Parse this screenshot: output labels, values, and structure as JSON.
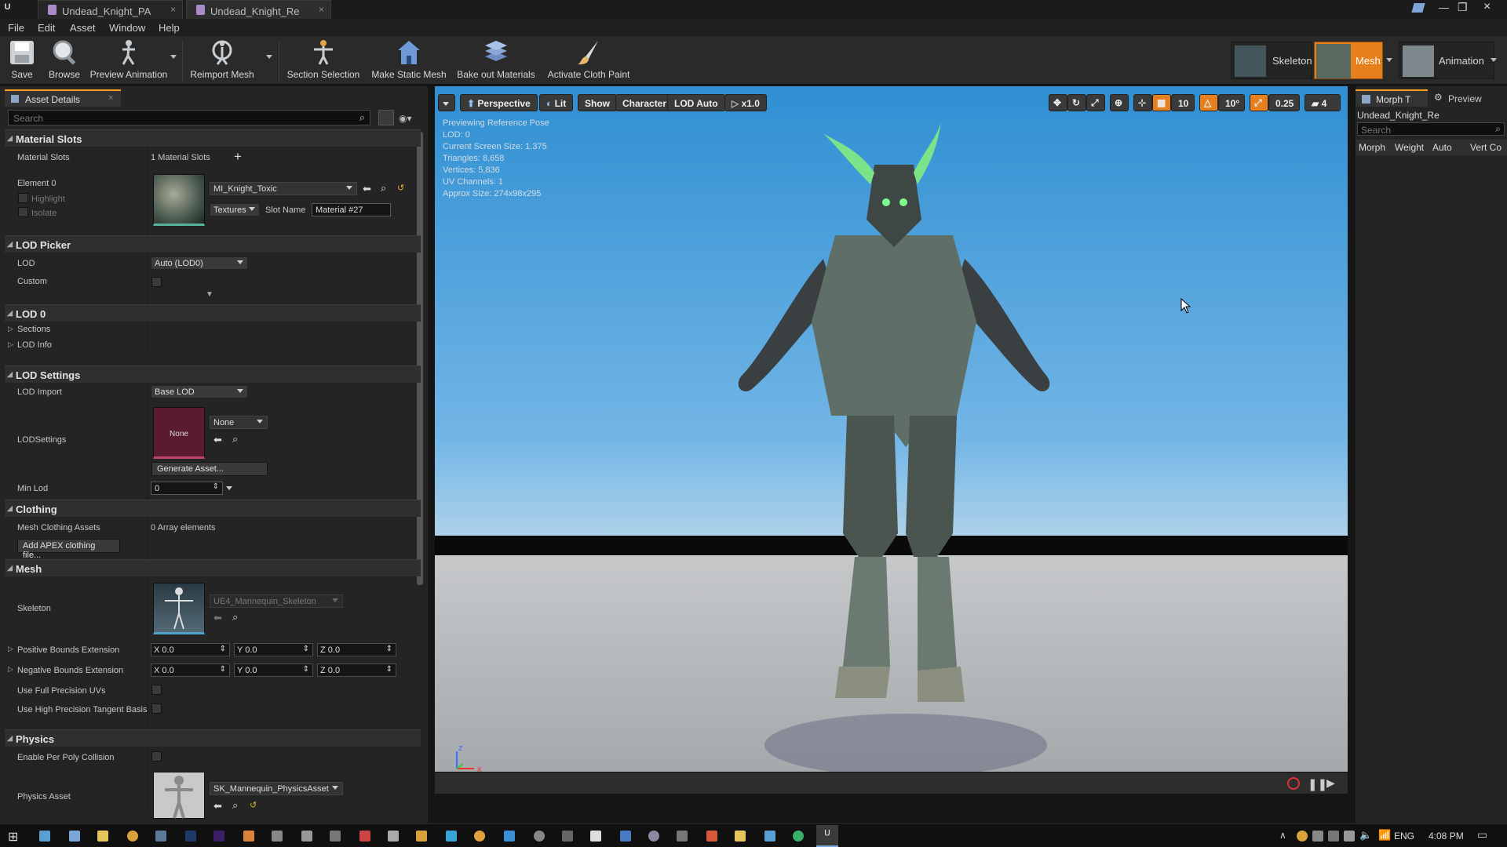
{
  "window": {
    "tabs": [
      "Undead_Knight_PA",
      "Undead_Knight_Re"
    ]
  },
  "menu": [
    "File",
    "Edit",
    "Asset",
    "Window",
    "Help"
  ],
  "toolbar": {
    "buttons": [
      "Save",
      "Browse",
      "Preview Animation",
      "Reimport Mesh",
      "Section Selection",
      "Make Static Mesh",
      "Bake out Materials",
      "Activate Cloth Paint"
    ],
    "modes": [
      "Skeleton",
      "Mesh",
      "Animation"
    ],
    "accent": "#ff9f1a"
  },
  "details": {
    "tab_label": "Asset Details",
    "search_placeholder": "Search",
    "sections": {
      "material_slots": "Material Slots",
      "lod_picker": "LOD Picker",
      "lod0": "LOD 0",
      "lod_settings": "LOD Settings",
      "clothing": "Clothing",
      "mesh": "Mesh",
      "physics": "Physics"
    },
    "material": {
      "label": "Material Slots",
      "count": "1 Material Slots",
      "element": "Element 0",
      "highlight": "Highlight",
      "isolate": "Isolate",
      "material_name": "MI_Knight_Toxic",
      "textures": "Textures",
      "slot_name_label": "Slot Name",
      "slot_name_value": "Material #27"
    },
    "lod_picker": {
      "lod_label": "LOD",
      "lod_value": "Auto (LOD0)",
      "custom_label": "Custom"
    },
    "lod0": {
      "sections": "Sections",
      "lod_info": "LOD Info"
    },
    "lod_settings": {
      "import_label": "LOD Import",
      "import_value": "Base LOD",
      "settings_label": "LODSettings",
      "thumb_text": "None",
      "settings_value": "None",
      "generate_btn": "Generate Asset...",
      "min_lod_label": "Min Lod",
      "min_lod_value": "0"
    },
    "clothing": {
      "assets_label": "Mesh Clothing Assets",
      "assets_value": "0 Array elements",
      "add_btn": "Add APEX clothing file..."
    },
    "mesh": {
      "skeleton_label": "Skeleton",
      "skeleton_value": "UE4_Mannequin_Skeleton",
      "pos_bounds": "Positive Bounds Extension",
      "neg_bounds": "Negative Bounds Extension",
      "x": "X",
      "y": "Y",
      "z": "Z",
      "val": "0.0",
      "full_precision": "Use Full Precision UVs",
      "high_precision": "Use High Precision Tangent Basis"
    },
    "physics": {
      "per_poly": "Enable Per Poly Collision",
      "asset_label": "Physics Asset",
      "asset_value": "SK_Mannequin_PhysicsAsset"
    }
  },
  "viewport": {
    "buttons": [
      "Perspective",
      "Lit",
      "Show",
      "Character",
      "LOD Auto",
      "x1.0"
    ],
    "right_values": [
      "10",
      "10°",
      "0.25",
      "4"
    ],
    "stats": [
      "Previewing Reference Pose",
      "LOD: 0",
      "Current Screen Size: 1.375",
      "Triangles: 8,658",
      "Vertices: 5,836",
      "UV Channels: 1",
      "Approx Size: 274x98x295"
    ],
    "axis_x": "x",
    "axis_z": "z"
  },
  "morph": {
    "tab1": "Morph T",
    "tab2": "Preview",
    "asset": "Undead_Knight_Re",
    "search_placeholder": "Search",
    "cols": [
      "Morph",
      "Weight",
      "Auto",
      "Vert Co"
    ]
  },
  "taskbar": {
    "lang": "ENG",
    "time": "4:08 PM"
  }
}
